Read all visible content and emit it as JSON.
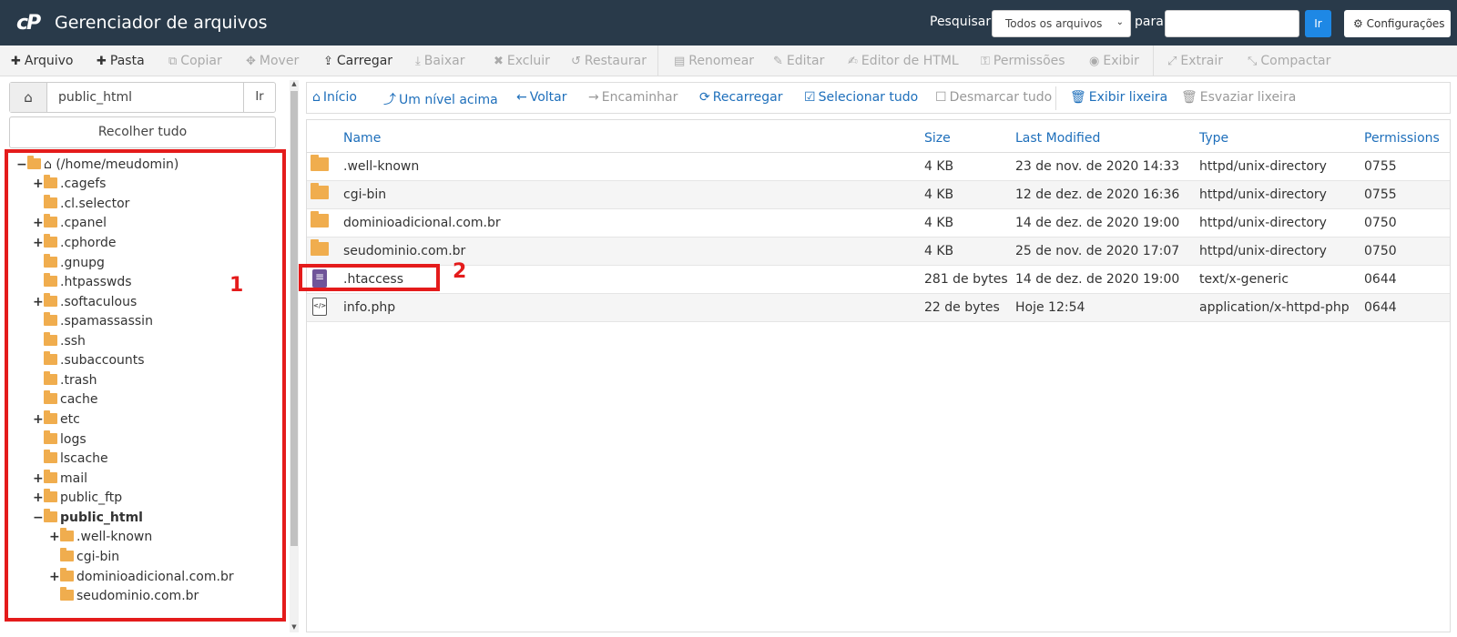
{
  "header": {
    "logo": "cP",
    "title": "Gerenciador de arquivos",
    "search_label": "Pesquisar",
    "search_scope": "Todos os arquivos",
    "para_label": "para",
    "search_value": "",
    "go_label": "Ir",
    "settings_label": "Configurações"
  },
  "toolbar": {
    "arquivo": "Arquivo",
    "pasta": "Pasta",
    "copiar": "Copiar",
    "mover": "Mover",
    "carregar": "Carregar",
    "baixar": "Baixar",
    "excluir": "Excluir",
    "restaurar": "Restaurar",
    "renomear": "Renomear",
    "editar": "Editar",
    "editor_html": "Editor de HTML",
    "permissoes": "Permissões",
    "exibir": "Exibir",
    "extrair": "Extrair",
    "compactar": "Compactar"
  },
  "sidebar": {
    "path_value": "public_html",
    "path_go": "Ir",
    "collapse_label": "Recolher tudo",
    "tree": {
      "root": "(/home/meudomin)",
      "items": [
        ".cagefs",
        ".cl.selector",
        ".cpanel",
        ".cphorde",
        ".gnupg",
        ".htpasswds",
        ".softaculous",
        ".spamassassin",
        ".ssh",
        ".subaccounts",
        ".trash",
        "cache",
        "etc",
        "logs",
        "lscache",
        "mail",
        "public_ftp",
        "public_html",
        ".well-known",
        "cgi-bin",
        "dominioadicional.com.br",
        "seudominio.com.br"
      ]
    },
    "annotation": "1"
  },
  "navbar": {
    "inicio": "Início",
    "nivel_acima": "Um nível acima",
    "voltar": "Voltar",
    "encaminhar": "Encaminhar",
    "recarregar": "Recarregar",
    "selecionar_tudo": "Selecionar tudo",
    "desmarcar_tudo": "Desmarcar tudo",
    "exibir_lixeira": "Exibir lixeira",
    "esvaziar_lixeira": "Esvaziar lixeira"
  },
  "table": {
    "headers": {
      "name": "Name",
      "size": "Size",
      "modified": "Last Modified",
      "type": "Type",
      "perms": "Permissions"
    },
    "rows": [
      {
        "name": ".well-known",
        "size": "4 KB",
        "modified": "23 de nov. de 2020 14:33",
        "type": "httpd/unix-directory",
        "perms": "0755"
      },
      {
        "name": "cgi-bin",
        "size": "4 KB",
        "modified": "12 de dez. de 2020 16:36",
        "type": "httpd/unix-directory",
        "perms": "0755"
      },
      {
        "name": "dominioadicional.com.br",
        "size": "4 KB",
        "modified": "14 de dez. de 2020 19:00",
        "type": "httpd/unix-directory",
        "perms": "0750"
      },
      {
        "name": "seudominio.com.br",
        "size": "4 KB",
        "modified": "25 de nov. de 2020 17:07",
        "type": "httpd/unix-directory",
        "perms": "0750"
      },
      {
        "name": ".htaccess",
        "size": "281 de bytes",
        "modified": "14 de dez. de 2020 19:00",
        "type": "text/x-generic",
        "perms": "0644"
      },
      {
        "name": "info.php",
        "size": "22 de bytes",
        "modified": "Hoje 12:54",
        "type": "application/x-httpd-php",
        "perms": "0644"
      }
    ],
    "annotation": "2"
  },
  "colors": {
    "header_bg": "#293a4a",
    "link": "#1e6fbb",
    "folder": "#f0ad4e",
    "highlight": "#e41b1b",
    "primary_button": "#1e88e5"
  }
}
